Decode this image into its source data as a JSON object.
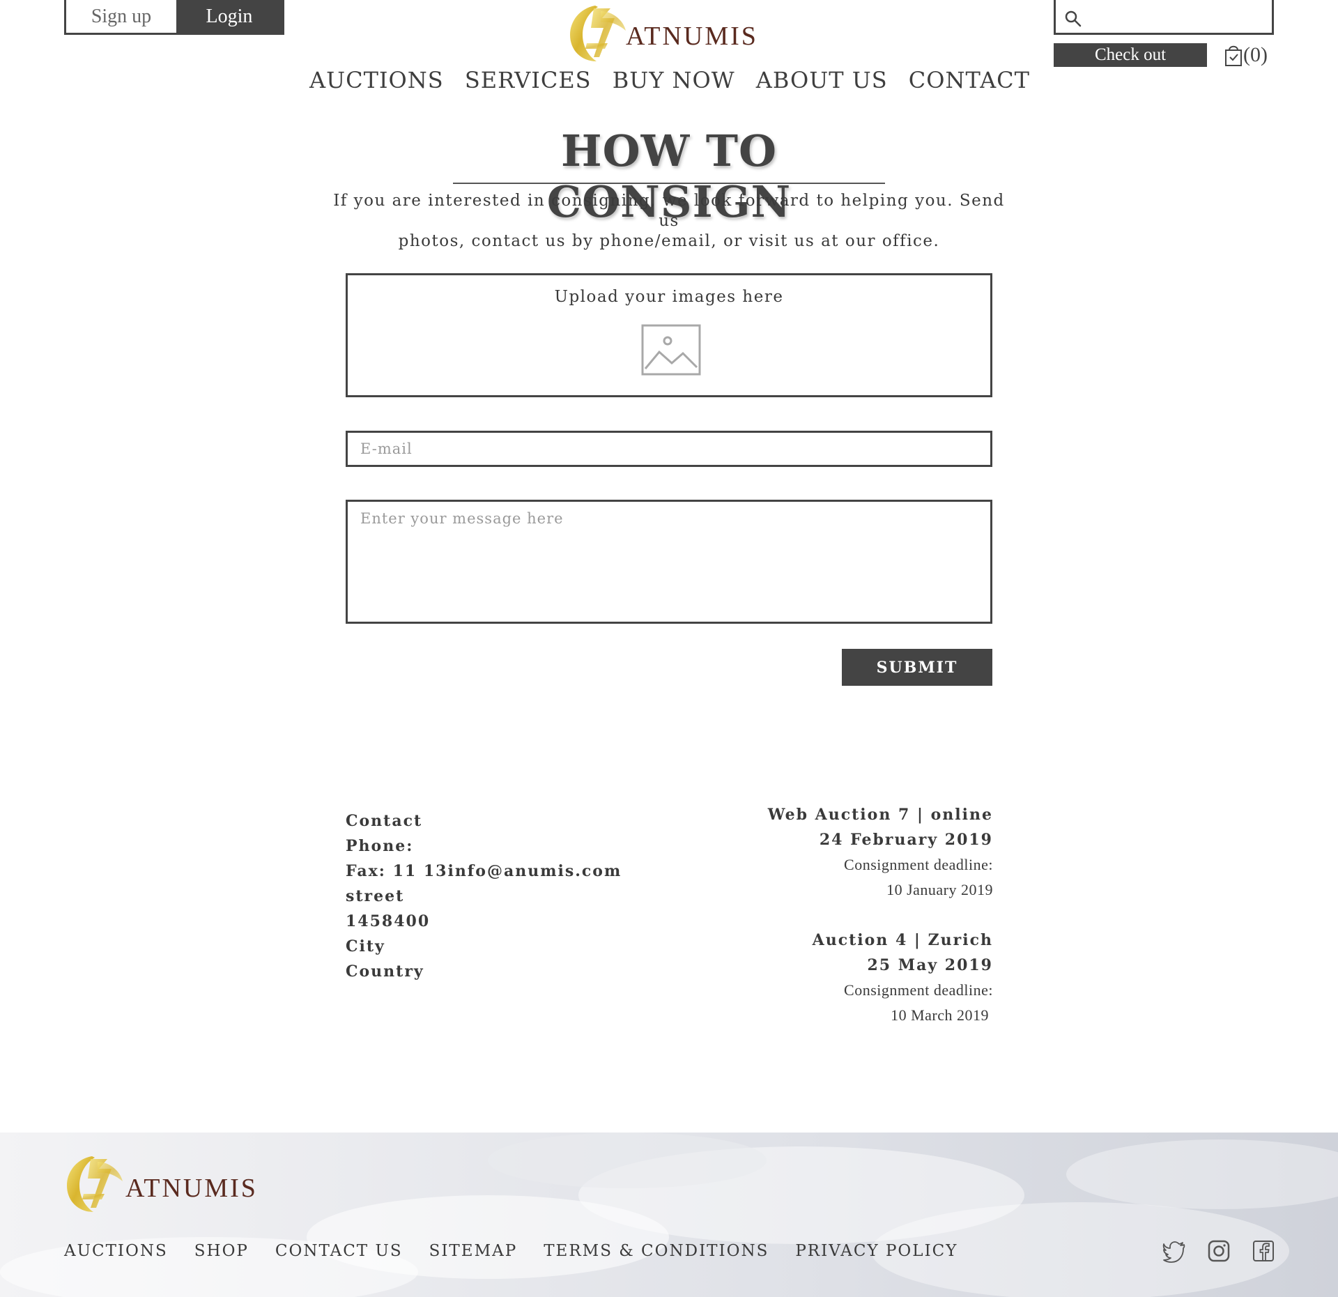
{
  "auth": {
    "signup_label": "Sign up",
    "login_label": "Login"
  },
  "brand": {
    "name": "ATNUMIS",
    "accent": "#d4b33a",
    "text_color": "#5a2a1f"
  },
  "header": {
    "search_placeholder": "",
    "checkout_label": "Check out",
    "cart_count": "(0)",
    "icons": [
      "search-icon",
      "shopping-bag-icon"
    ]
  },
  "nav": {
    "items": [
      {
        "label": "AUCTIONS"
      },
      {
        "label": "SERVICES"
      },
      {
        "label": "BUY NOW"
      },
      {
        "label": "ABOUT US"
      },
      {
        "label": "CONTACT"
      }
    ]
  },
  "hero": {
    "title": "HOW TO CONSIGN",
    "intro_line1": "If you are interested in consigning, we look forward to helping you. Send us",
    "intro_line2": "photos, contact us by phone/email, or visit us at our office."
  },
  "form": {
    "upload_label": "Upload your images here",
    "upload_icon": "image-placeholder-icon",
    "email_placeholder": "E-mail",
    "message_placeholder": "Enter your message here",
    "submit_label": "SUBMIT"
  },
  "contact": {
    "lines": [
      "Contact",
      "Phone:",
      "Fax: 11 13info@anumis.com",
      "street",
      "1458400",
      "City",
      "Country"
    ]
  },
  "auctions": [
    {
      "title": "Web Auction 7 | online",
      "date": "24 February 2019",
      "deadline_label": "Consignment deadline:",
      "deadline_date": "10 January 2019"
    },
    {
      "title": "Auction 4 | Zurich",
      "date": "25 May 2019",
      "deadline_label": "Consignment deadline:",
      "deadline_date": "10 March 2019"
    }
  ],
  "footer": {
    "links": [
      {
        "label": "AUCTIONS"
      },
      {
        "label": "SHOP"
      },
      {
        "label": "CONTACT US"
      },
      {
        "label": "SITEMAP"
      },
      {
        "label": "TERMS & CONDITIONS"
      },
      {
        "label": "PRIVACY POLICY"
      }
    ],
    "social": [
      "twitter-icon",
      "instagram-icon",
      "facebook-icon"
    ]
  }
}
